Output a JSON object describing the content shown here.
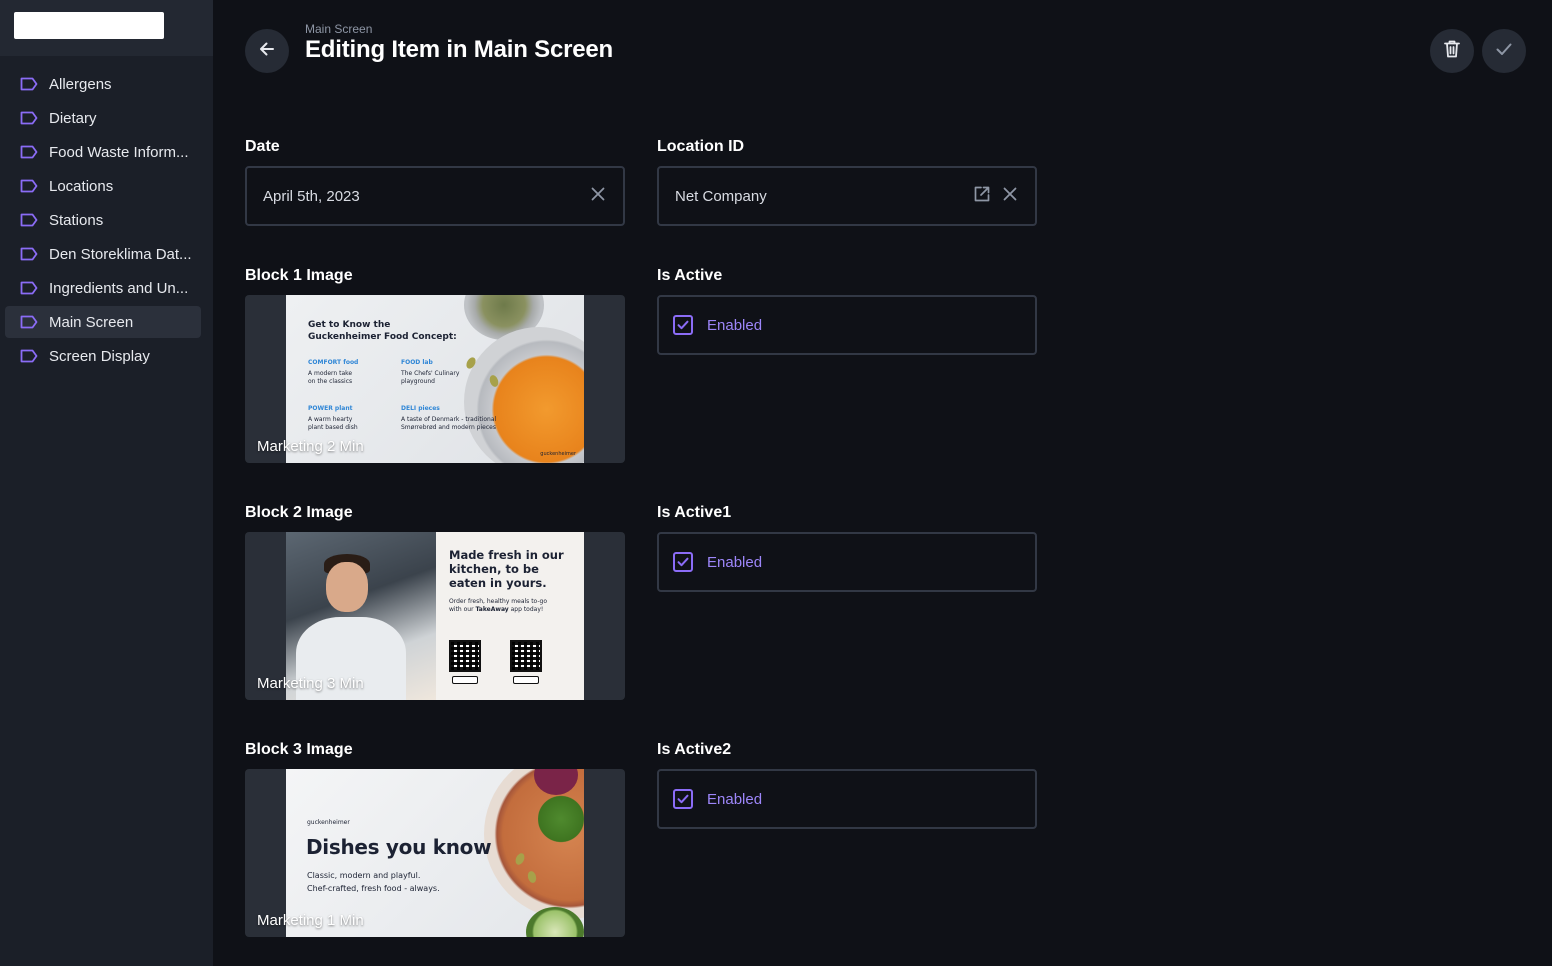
{
  "sidebar": {
    "items": [
      {
        "label": "Allergens",
        "active": false
      },
      {
        "label": "Dietary",
        "active": false
      },
      {
        "label": "Food Waste Inform...",
        "active": false
      },
      {
        "label": "Locations",
        "active": false
      },
      {
        "label": "Stations",
        "active": false
      },
      {
        "label": "Den Storeklima Dat...",
        "active": false
      },
      {
        "label": "Ingredients and Un...",
        "active": false
      },
      {
        "label": "Main Screen",
        "active": true
      },
      {
        "label": "Screen Display",
        "active": false
      }
    ]
  },
  "header": {
    "breadcrumb": "Main Screen",
    "title": "Editing Item in Main Screen"
  },
  "form": {
    "date": {
      "label": "Date",
      "value": "April 5th, 2023"
    },
    "location": {
      "label": "Location ID",
      "value": "Net Company"
    },
    "block1": {
      "label": "Block 1 Image",
      "caption": "Marketing 2 Min"
    },
    "active1": {
      "label": "Is Active",
      "value": "Enabled",
      "checked": true
    },
    "block2": {
      "label": "Block 2 Image",
      "caption": "Marketing 3 Min"
    },
    "active2": {
      "label": "Is Active1",
      "value": "Enabled",
      "checked": true
    },
    "block3": {
      "label": "Block 3 Image",
      "caption": "Marketing 1 Min"
    },
    "active3": {
      "label": "Is Active2",
      "value": "Enabled",
      "checked": true
    }
  },
  "thumbs": {
    "t1": {
      "headline1": "Get to Know the",
      "headline2": "Guckenheimer Food Concept:",
      "c1_cap": "COMFORT food",
      "c1_l1": "A modern take",
      "c1_l2": "on the classics",
      "c2_cap": "FOOD lab",
      "c2_l1": "The Chefs' Culinary",
      "c2_l2": "playground",
      "c3_cap": "POWER plant",
      "c3_l1": "A warm hearty",
      "c3_l2": "plant based dish",
      "c4_cap": "DELI pieces",
      "c4_l1": "A taste of Denmark - traditional",
      "c4_l2": "Smørrebrød and modern pieces",
      "brand": "guckenheimer"
    },
    "t2": {
      "headline": "Made fresh in our kitchen, to be eaten in yours.",
      "sub1": "Order fresh, healthy meals to-go",
      "sub2_pre": "with our ",
      "sub2_bold": "TakeAway",
      "sub2_post": " app today!"
    },
    "t3": {
      "brand": "guckenheimer",
      "title": "Dishes you know",
      "sub1": "Classic, modern and playful.",
      "sub2": "Chef-crafted, fresh food - always."
    }
  },
  "colors": {
    "accent": "#8b6cf6",
    "background": "#0f1117",
    "sidebar": "#1b1f28"
  }
}
